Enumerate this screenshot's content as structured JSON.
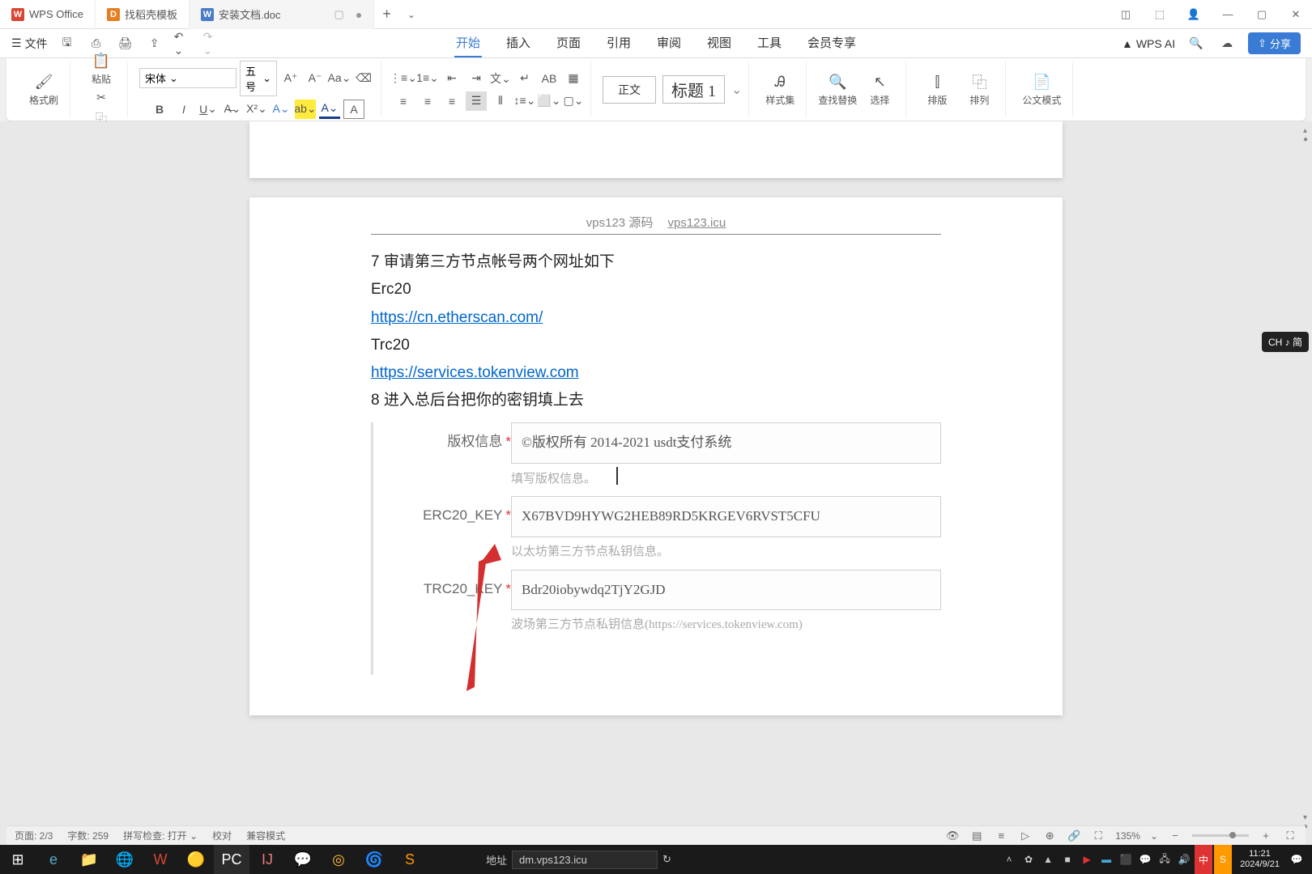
{
  "tabs": [
    {
      "label": "WPS Office",
      "icon": "W"
    },
    {
      "label": "找稻壳模板",
      "icon": "D"
    },
    {
      "label": "安装文档.doc",
      "icon": "W",
      "active": true
    }
  ],
  "menu": {
    "file": "文件",
    "items": [
      "开始",
      "插入",
      "页面",
      "引用",
      "审阅",
      "视图",
      "工具",
      "会员专享"
    ],
    "active": "开始",
    "wps_ai": "WPS AI",
    "share": "分享"
  },
  "ribbon": {
    "format_painter": "格式刷",
    "paste": "粘贴",
    "font_family": "宋体",
    "font_size": "五号",
    "style_normal": "正文",
    "style_heading": "标题 1",
    "styles": "样式集",
    "find": "查找替换",
    "select": "选择",
    "layout": "排版",
    "sort": "排列",
    "doc_mode": "公文模式"
  },
  "doc": {
    "header_left": "vps123 源码",
    "header_right": "vps123.icu",
    "line1": "7  审请第三方节点帐号两个网址如下",
    "erc20": "Erc20",
    "link1": "https://cn.etherscan.com/",
    "trc20": "Trc20",
    "link2": "https://services.tokenview.com",
    "line8": "8 进入总后台把你的密钥填上去",
    "form": {
      "copyright_label": "版权信息",
      "copyright_value": "©版权所有 2014-2021 usdt支付系统",
      "copyright_hint": "填写版权信息。",
      "erc20_label": "ERC20_KEY",
      "erc20_value": "X67BVD9HYWG2HEB89RD5KRGEV6RVST5CFU",
      "erc20_hint": "以太坊第三方节点私钥信息。",
      "trc20_label": "TRC20_KEY",
      "trc20_value": "Bdr20iobywdq2TjY2GJD",
      "trc20_hint": "波场第三方节点私钥信息(https://services.tokenview.com)"
    }
  },
  "status": {
    "page": "页面: 2/3",
    "words": "字数: 259",
    "spell": "拼写检查: 打开",
    "proof": "校对",
    "compat": "兼容模式",
    "zoom": "135%",
    "addr_label": "地址",
    "addr_value": "dm.vps123.icu"
  },
  "ime": "CH ♪ 简",
  "clock": {
    "time": "11:21",
    "date": "2024/9/21"
  }
}
